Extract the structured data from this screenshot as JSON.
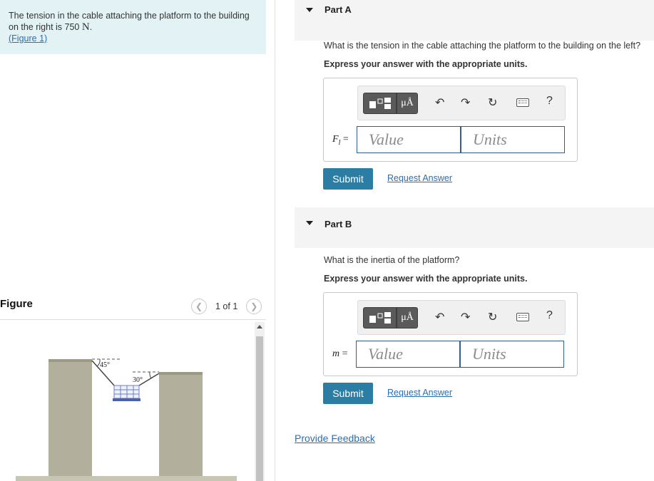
{
  "problem": {
    "text": "The tension in the cable attaching the platform to the building on the right is 750",
    "unit": "N",
    "after_unit": ".",
    "figure_link": "(Figure 1)"
  },
  "figure": {
    "title": "Figure",
    "pager": "1 of 1",
    "angle_left": "45°",
    "angle_right": "30°"
  },
  "partA": {
    "title": "Part A",
    "question": "What is the tension in the cable attaching the platform to the building on the left?",
    "instruction": "Express your answer with the appropriate units.",
    "var_main": "F",
    "var_sub": "l",
    "var_eq": " =",
    "value_placeholder": "Value",
    "units_placeholder": "Units",
    "submit": "Submit",
    "request_answer": "Request Answer"
  },
  "partB": {
    "title": "Part B",
    "question": "What is the inertia of the platform?",
    "instruction": "Express your answer with the appropriate units.",
    "var_main": "m",
    "var_eq": " =",
    "value_placeholder": "Value",
    "units_placeholder": "Units",
    "submit": "Submit",
    "request_answer": "Request Answer"
  },
  "toolbar": {
    "units_symbol": "μÅ",
    "undo_icon": "↶",
    "redo_icon": "↷",
    "reset_icon": "↻",
    "help": "?"
  },
  "feedback": "Provide Feedback",
  "colors": {
    "accent": "#2b7da3",
    "link": "#2a6eb0",
    "problem_bg": "#e3f3f5",
    "building": "#b2b09c",
    "platform": "#4a63a8"
  }
}
